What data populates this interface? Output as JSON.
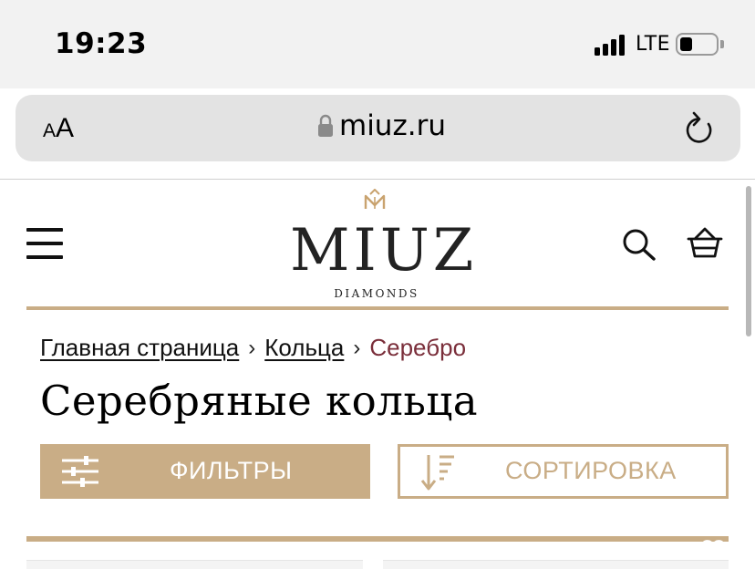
{
  "status_bar": {
    "time": "19:23",
    "network": "LTE",
    "icons": [
      "signal-bars-icon",
      "battery-icon"
    ]
  },
  "browser": {
    "text_size_small": "A",
    "text_size_large": "A",
    "url": "miuz.ru",
    "icons": [
      "lock-icon",
      "reload-icon"
    ]
  },
  "header": {
    "brand": "MIUZ",
    "brand_sub": "DIAMONDS",
    "icons": [
      "menu-icon",
      "logo-mark-icon",
      "search-icon",
      "basket-icon"
    ]
  },
  "breadcrumb": {
    "items": [
      "Главная страница",
      "Кольца",
      "Серебро"
    ],
    "separator": "›"
  },
  "page": {
    "title": "Серебряные кольца"
  },
  "controls": {
    "filters_label": "ФИЛЬТРЫ",
    "sort_label": "СОРТИРОВКА"
  },
  "colors": {
    "accent_gold": "#c9ad86",
    "breadcrumb_current": "#7a2e3a",
    "status_bg": "#f2f2f2",
    "urlbar_bg": "#e3e3e3"
  }
}
